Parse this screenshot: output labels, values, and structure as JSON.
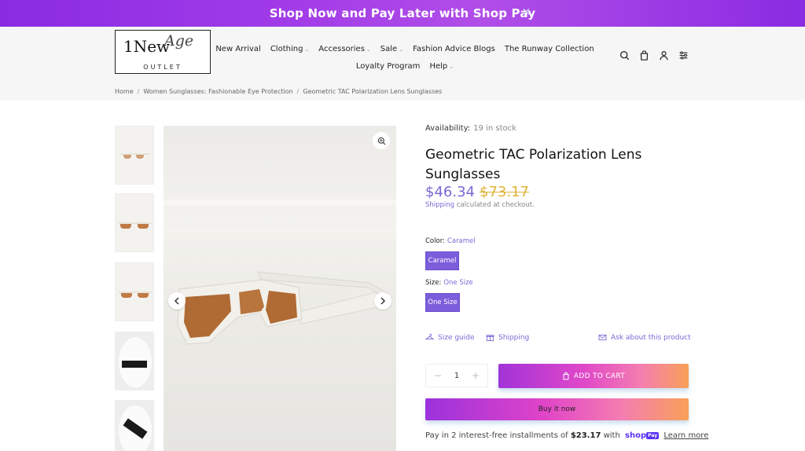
{
  "announcement": {
    "text": "Shop Now and Pay Later with Shop Pay",
    "close": "×"
  },
  "logo": {
    "main": "1New",
    "script": "Age",
    "sub": "OUTLET"
  },
  "nav": {
    "row1": [
      {
        "label": "New Arrival",
        "dropdown": false
      },
      {
        "label": "Clothing",
        "dropdown": true
      },
      {
        "label": "Accessories",
        "dropdown": true
      },
      {
        "label": "Sale",
        "dropdown": true
      },
      {
        "label": "Fashion Advice Blogs",
        "dropdown": false
      },
      {
        "label": "The Runway Collection",
        "dropdown": false
      }
    ],
    "row2": [
      {
        "label": "Loyalty Program",
        "dropdown": false
      },
      {
        "label": "Help",
        "dropdown": true
      }
    ]
  },
  "header_icons": [
    "search-icon",
    "bag-icon",
    "account-icon",
    "settings-sliders-icon"
  ],
  "breadcrumb": [
    "Home",
    "Women Sunglasses: Fashionable Eye Protection",
    "Geometric TAC Polarization Lens Sunglasses"
  ],
  "product": {
    "availability_label": "Availability:",
    "availability_value": "19 in stock",
    "title": "Geometric TAC Polarization Lens Sunglasses",
    "price": "$46.34",
    "compare_price": "$73.17",
    "shipping_link": "Shipping",
    "shipping_note": "calculated at checkout.",
    "color_label": "Color:",
    "color_value": "Caramel",
    "color_option": "Caramel",
    "size_label": "Size:",
    "size_value": "One Size",
    "size_option": "One Size",
    "size_guide": "Size guide",
    "shipping": "Shipping",
    "ask": "Ask about this product",
    "quantity": "1",
    "add_to_cart": "ADD TO CART",
    "buy_now": "Buy it now",
    "installments_pre": "Pay in 2 interest-free installments of",
    "installments_amount": "$23.17",
    "installments_with": "with",
    "shoppay_text": "shop",
    "shoppay_badge": "Pay",
    "learn_more": "Learn more"
  },
  "colors": {
    "accent": "#7b68d6",
    "compare": "#e0b438",
    "announce": "#8a2be2"
  }
}
